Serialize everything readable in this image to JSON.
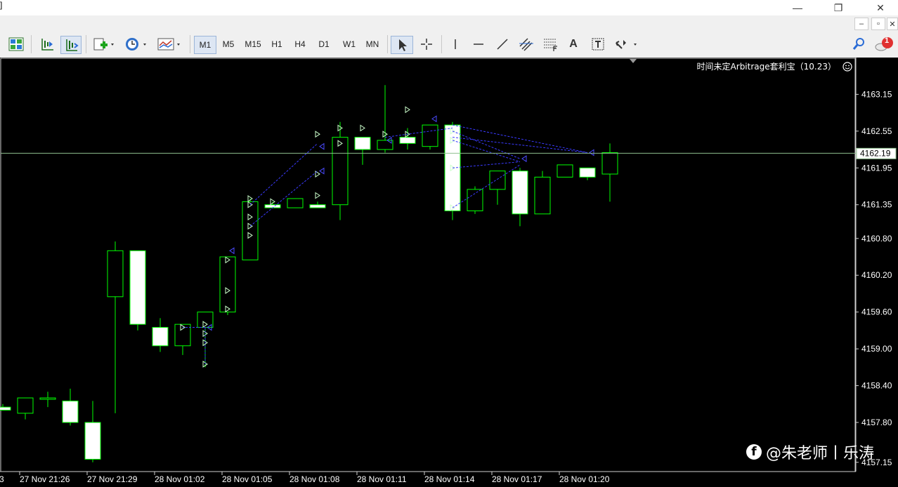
{
  "window": {
    "edge_text": "]",
    "minimize": "—",
    "restore": "❐",
    "close": "✕",
    "mdi_minimize": "–",
    "mdi_restore": "▫",
    "mdi_close": "✕"
  },
  "toolbar": {
    "timeframes": [
      "M1",
      "M5",
      "M15",
      "H1",
      "H4",
      "D1",
      "W1",
      "MN"
    ],
    "active_timeframe": "M1",
    "text_tool": "A",
    "notification_count": "1"
  },
  "chart": {
    "indicator_label": "时间未定Arbitrage套利宝（10.23）",
    "current_price_label": "4162.19",
    "colors": {
      "background": "#000000",
      "bull": "#00ff00",
      "bear_body": "#ffffff",
      "arrows": "#3333ff",
      "price_line": "#8fbf8f"
    }
  },
  "chart_data": {
    "type": "candlestick",
    "y_ticks": [
      "4163.15",
      "4162.55",
      "4161.95",
      "4161.35",
      "4160.80",
      "4160.20",
      "4159.60",
      "4159.00",
      "4158.40",
      "4157.80",
      "4157.15"
    ],
    "x_ticks": [
      "27 Nov 21:26",
      "27 Nov 21:29",
      "28 Nov 01:02",
      "28 Nov 01:05",
      "28 Nov 01:08",
      "28 Nov 01:11",
      "28 Nov 01:14",
      "28 Nov 01:17",
      "28 Nov 01:20"
    ],
    "left_edge_label": "3",
    "current_price": 4162.19,
    "ylim": [
      4157.15,
      4163.55
    ],
    "candles": [
      {
        "o": 4158.05,
        "h": 4158.1,
        "l": 4158.0,
        "c": 4158.0
      },
      {
        "o": 4157.95,
        "h": 4158.2,
        "l": 4157.85,
        "c": 4158.2
      },
      {
        "o": 4158.2,
        "h": 4158.3,
        "l": 4158.05,
        "c": 4158.2
      },
      {
        "o": 4158.15,
        "h": 4158.35,
        "l": 4157.75,
        "c": 4157.8
      },
      {
        "o": 4157.8,
        "h": 4158.15,
        "l": 4157.15,
        "c": 4157.2
      },
      {
        "o": 4159.85,
        "h": 4160.75,
        "l": 4157.95,
        "c": 4160.6
      },
      {
        "o": 4160.6,
        "h": 4160.6,
        "l": 4159.3,
        "c": 4159.4
      },
      {
        "o": 4159.35,
        "h": 4159.5,
        "l": 4158.95,
        "c": 4159.05
      },
      {
        "o": 4159.05,
        "h": 4159.4,
        "l": 4158.9,
        "c": 4159.4
      },
      {
        "o": 4159.35,
        "h": 4159.6,
        "l": 4158.7,
        "c": 4159.6
      },
      {
        "o": 4159.6,
        "h": 4160.45,
        "l": 4159.55,
        "c": 4160.5
      },
      {
        "o": 4160.45,
        "h": 4161.45,
        "l": 4160.45,
        "c": 4161.4
      },
      {
        "o": 4161.35,
        "h": 4161.4,
        "l": 4161.3,
        "c": 4161.3
      },
      {
        "o": 4161.3,
        "h": 4161.45,
        "l": 4161.3,
        "c": 4161.45
      },
      {
        "o": 4161.35,
        "h": 4161.4,
        "l": 4161.3,
        "c": 4161.3
      },
      {
        "o": 4161.35,
        "h": 4162.7,
        "l": 4161.1,
        "c": 4162.45
      },
      {
        "o": 4162.45,
        "h": 4162.45,
        "l": 4162.0,
        "c": 4162.25
      },
      {
        "o": 4162.25,
        "h": 4163.3,
        "l": 4162.2,
        "c": 4162.4
      },
      {
        "o": 4162.45,
        "h": 4162.6,
        "l": 4162.25,
        "c": 4162.35
      },
      {
        "o": 4162.3,
        "h": 4162.65,
        "l": 4162.25,
        "c": 4162.65
      },
      {
        "o": 4162.65,
        "h": 4162.7,
        "l": 4161.1,
        "c": 4161.25
      },
      {
        "o": 4161.25,
        "h": 4161.65,
        "l": 4161.2,
        "c": 4161.6
      },
      {
        "o": 4161.6,
        "h": 4161.9,
        "l": 4161.35,
        "c": 4161.9
      },
      {
        "o": 4161.9,
        "h": 4161.95,
        "l": 4161.0,
        "c": 4161.2
      },
      {
        "o": 4161.2,
        "h": 4161.9,
        "l": 4161.2,
        "c": 4161.8
      },
      {
        "o": 4161.8,
        "h": 4162.0,
        "l": 4161.8,
        "c": 4162.0
      },
      {
        "o": 4161.95,
        "h": 4161.95,
        "l": 4161.75,
        "c": 4161.8
      },
      {
        "o": 4161.85,
        "h": 4162.35,
        "l": 4161.4,
        "c": 4162.2
      }
    ]
  },
  "watermark": {
    "icon": "f",
    "text": "@朱老师丨乐涛"
  }
}
